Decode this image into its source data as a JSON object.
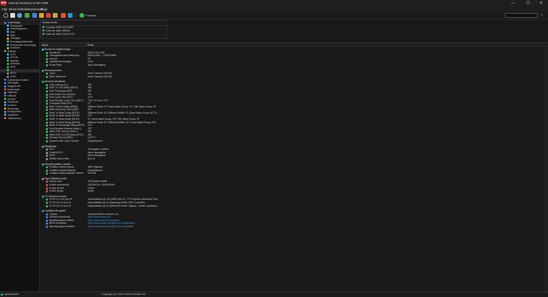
{
  "window": {
    "logo": "AIDA",
    "title": "AIDA64 Extreme v7.60.7300",
    "minimize": "—",
    "maximize": "☐",
    "close": "✕"
  },
  "menu": [
    "Fájl",
    "Nézet",
    "Jelentés",
    "Kedvencek",
    "Súgó"
  ],
  "toolbar": {
    "updates_label": "Frissítés",
    "search_placeholder": "",
    "search_icon": "⌕",
    "icons": [
      "refresh-icon",
      "report-icon",
      "cloud-icon",
      "monitor-icon",
      "cpu-icon",
      "folder-icon",
      "sensor-icon",
      "memory-icon",
      "benchmark-icon",
      "monitor-diag-icon",
      "update-icon"
    ]
  },
  "sidebar": {
    "header": "",
    "items": [
      {
        "label": "Számítógép",
        "indent": 0,
        "color": "#3a7bd5",
        "expanded": true
      },
      {
        "label": "Összegzés",
        "indent": 1,
        "color": "#4aa3df"
      },
      {
        "label": "Számítógépnév",
        "indent": 1,
        "color": "#4aa3df"
      },
      {
        "label": "DMI",
        "indent": 1,
        "color": "#4aa3df"
      },
      {
        "label": "IPMI",
        "indent": 1,
        "color": "#4aa3df"
      },
      {
        "label": "Túlhajtás",
        "indent": 1,
        "color": "#e0a030"
      },
      {
        "label": "Energiagazdálkodás",
        "indent": 1,
        "color": "#5ab04a"
      },
      {
        "label": "Hordozható számítógép",
        "indent": 1,
        "color": "#4aa3df"
      },
      {
        "label": "Érzékelő",
        "indent": 1,
        "color": "#d9a03a"
      },
      {
        "label": "Alaplap",
        "indent": 0,
        "color": "#3aa55a",
        "expanded": true
      },
      {
        "label": "CPU",
        "indent": 1,
        "color": "#4aa3df"
      },
      {
        "label": "CPUID",
        "indent": 1,
        "color": "#4aa3df"
      },
      {
        "label": "Alaplap",
        "indent": 1,
        "color": "#3aa55a"
      },
      {
        "label": "Memória",
        "indent": 1,
        "color": "#3aa55a"
      },
      {
        "label": "SPD",
        "indent": 1,
        "color": "#3aa55a"
      },
      {
        "label": "",
        "indent": 1,
        "color": "#3aa55a",
        "selected": true
      },
      {
        "label": "BIOS",
        "indent": 1,
        "color": "#888"
      },
      {
        "label": "ACPI",
        "indent": 1,
        "color": "#888"
      },
      {
        "label": "Operációs rendszer",
        "indent": 0,
        "color": "#3a7bd5"
      },
      {
        "label": "Kiszolgáló",
        "indent": 0,
        "color": "#3a7bd5"
      },
      {
        "label": "Megjelenítő",
        "indent": 0,
        "color": "#3a7bd5"
      },
      {
        "label": "Multimédia",
        "indent": 0,
        "color": "#c05050"
      },
      {
        "label": "Háttértár",
        "indent": 0,
        "color": "#888"
      },
      {
        "label": "Hálózat",
        "indent": 0,
        "color": "#3a7bd5"
      },
      {
        "label": "DirectX",
        "indent": 0,
        "color": "#5ab04a"
      },
      {
        "label": "Eszközök",
        "indent": 0,
        "color": "#4aa3df"
      },
      {
        "label": "Szoftver",
        "indent": 0,
        "color": "#4aa3df"
      },
      {
        "label": "Biztonság",
        "indent": 0,
        "color": "#d9a03a"
      },
      {
        "label": "Konfiguráció",
        "indent": 0,
        "color": "#888"
      },
      {
        "label": "Adatbázis",
        "indent": 0,
        "color": "#4aa3df"
      },
      {
        "label": "Teljesítmény",
        "indent": 0,
        "color": "#e05050"
      }
    ]
  },
  "devices": {
    "header": "Eszköz leírás",
    "items": [
      "Cpuírás: AMD K19.6 IMC",
      "Dolk hid: AMD SB5XE",
      "Dolk hid: AMD K19.6 FCH"
    ]
  },
  "columns": {
    "field": "Mező",
    "value": "Érték"
  },
  "rows": [
    {
      "t": "sec",
      "label": "Északi hid tulajdonságai",
      "color": "#4aa3df"
    },
    {
      "t": "item",
      "label": "Északi híd",
      "value": "AMD K19.6 IMC",
      "color": "#3aa55a"
    },
    {
      "t": "item",
      "label": "Támogatott memóriatípusok",
      "value": "DDR5-3000 ... DDR5-5600",
      "color": "#3aa55a"
    },
    {
      "t": "item",
      "label": "Revízió",
      "value": "00",
      "color": "#3aa55a"
    },
    {
      "t": "item",
      "label": "Gyártási technológia",
      "value": "5 nm",
      "color": "#3aa55a"
    },
    {
      "t": "item",
      "label": "Probe Filter",
      "value": "Nincs támogatva",
      "color": "#3aa55a"
    },
    {
      "t": "gap"
    },
    {
      "t": "sec",
      "label": "Memóriavezérlő",
      "color": "#3aa55a"
    },
    {
      "t": "item",
      "label": "Típus",
      "value": "Dual Channel (128 bit)",
      "color": "#3aa55a"
    },
    {
      "t": "item",
      "label": "Aktív üzemmód",
      "value": "Dual Channel (128 bit)",
      "color": "#3aa55a"
    },
    {
      "t": "gap"
    },
    {
      "t": "sec",
      "label": "Memória időzítések",
      "color": "#3aa55a"
    },
    {
      "t": "item",
      "label": "CAS Latency (CL)",
      "value": "38T",
      "color": "#3aa55a"
    },
    {
      "t": "item",
      "label": "RAS To CAS Delay (tRCD)",
      "value": "38T",
      "color": "#3aa55a"
    },
    {
      "t": "item",
      "label": "RAS Precharge (tRP)",
      "value": "38T",
      "color": "#3aa55a"
    },
    {
      "t": "item",
      "label": "RAS Active Time (tRAS)",
      "value": "76T",
      "color": "#3aa55a"
    },
    {
      "t": "item",
      "label": "Row Cycle Time (tRC)",
      "value": "112T",
      "color": "#3aa55a"
    },
    {
      "t": "item",
      "label": "Row Refresh Cycle Time (tRFC)",
      "value": "712T, 2x Fine 712T",
      "color": "#3aa55a"
    },
    {
      "t": "item",
      "label": "Command Rate (CR)",
      "value": "1T",
      "color": "#3aa55a"
    },
    {
      "t": "item",
      "label": "RAS To RAS Delay (tRRD)",
      "value": "Different Rank: 0T, Same Bank Group: 11T, Diff. Bank Group: 8T",
      "color": "#3aa55a"
    },
    {
      "t": "item",
      "label": "Write Recovery Time (tWR)",
      "value": "90T",
      "color": "#3aa55a"
    },
    {
      "t": "item",
      "label": "Read To Read Delay (tRTR)",
      "value": "Different Rank: 8T, Different DIMM: 9T, Same Bank Group: 8T, Di...",
      "color": "#3aa55a"
    },
    {
      "t": "item",
      "label": "Read To Write Delay (tRTW)",
      "value": "22T",
      "color": "#3aa55a"
    },
    {
      "t": "item",
      "label": "Write To Read Delay (tWTR)",
      "value": "6T, Same Bank Group: 20T, Diff. Bank Group: 6T",
      "color": "#3aa55a"
    },
    {
      "t": "item",
      "label": "Write To Write Delay (tWTW)",
      "value": "Different Rank: 8T, Different DIMM: 10T, Same Bank Group: 2ST...",
      "color": "#3aa55a"
    },
    {
      "t": "item",
      "label": "Read To Precharge Delay (tRTP)",
      "value": "23T",
      "color": "#3aa55a"
    },
    {
      "t": "item",
      "label": "Four Activate Window Delay (...",
      "value": "32T",
      "color": "#3aa55a"
    },
    {
      "t": "item",
      "label": "Write CAS Latency (tWCL)",
      "value": "36T",
      "color": "#3aa55a"
    },
    {
      "t": "item",
      "label": "Write RAS To CAS Delay (tRCD...",
      "value": "38T",
      "color": "#3aa55a"
    },
    {
      "t": "item",
      "label": "Refresh Period (tREF)",
      "value": "11677T",
      "color": "#3aa55a"
    },
    {
      "t": "item",
      "label": "Dynamic Idle Cycle Counter",
      "value": "Engedélyezve",
      "color": "#3aa55a"
    },
    {
      "t": "gap"
    },
    {
      "t": "sec",
      "label": "Hibajavítás",
      "color": "#3aa55a"
    },
    {
      "t": "item",
      "label": "ECC",
      "value": "Támogatva, Letiltva",
      "color": "#888"
    },
    {
      "t": "item",
      "label": "ChipKill ECC",
      "value": "Nincs támogatva",
      "color": "#888"
    },
    {
      "t": "item",
      "label": "RAID",
      "value": "Nincs támogatva",
      "color": "#888"
    },
    {
      "t": "item",
      "label": "DRAM Scrub Rate",
      "value": "640 ns",
      "color": "#888"
    },
    {
      "t": "gap"
    },
    {
      "t": "sec",
      "label": "Integrált grafikus vezérlő",
      "color": "#3aa55a"
    },
    {
      "t": "item",
      "label": "Grafikus vezérlő típusa",
      "value": "AMD Raphael",
      "color": "#3aa55a"
    },
    {
      "t": "item",
      "label": "Grafikus vezérlő állapota",
      "value": "Engedélyezve",
      "color": "#3aa55a"
    },
    {
      "t": "item",
      "label": "Grafikus képkockapuffer mérete",
      "value": "512 MB",
      "color": "#3aa55a"
    },
    {
      "t": "gap"
    },
    {
      "t": "sec",
      "label": "High Definition Audio",
      "color": "#888"
    },
    {
      "t": "item",
      "label": "Kodek neve",
      "value": "ATI Radeon HDMI",
      "color": "#c05050"
    },
    {
      "t": "item",
      "label": "Kodek azonosítója",
      "value": "1002AA01h / 00AA0100h",
      "color": "#c05050"
    },
    {
      "t": "item",
      "label": "Kodek revízió",
      "value": "1000h",
      "color": "#c05050"
    },
    {
      "t": "item",
      "label": "Kodek típusa",
      "value": "Audio",
      "color": "#c05050"
    },
    {
      "t": "gap"
    },
    {
      "t": "sec",
      "label": "PCI Express vezérlő",
      "color": "#3aa55a"
    },
    {
      "t": "item",
      "label": "PCI-E 5.0 x16 port #1",
      "value": "Használatban @ x16 (AMD Navi 10 - PCI Express Upstream Swit...",
      "color": "#3aa55a"
    },
    {
      "t": "item",
      "label": "PCI-E 5.0 x4 port #1",
      "value": "Használatban @ x4 (Samsung NVMe SSD Controller)",
      "color": "#3aa55a"
    },
    {
      "t": "item",
      "label": "PCI-E 5.0 x4 port #1",
      "value": "Használatban @ x4 (AMD 600 Series Chipset - Switch Upstream ...",
      "color": "#3aa55a"
    },
    {
      "t": "gap"
    },
    {
      "t": "sec",
      "label": "Lapkakészlet gyártó",
      "color": "#3a7bd5"
    },
    {
      "t": "item",
      "label": "Cégnév",
      "value": "Advanced Micro Devices, Inc.",
      "color": "#3a7bd5"
    },
    {
      "t": "item",
      "label": "Termék információk",
      "value": "https://www.amd.com",
      "link": true,
      "color": "#3a7bd5"
    },
    {
      "t": "item",
      "label": "Illesztőprogram letöltés",
      "value": "https://www.amd.com/support",
      "link": true,
      "color": "#3a7bd5"
    },
    {
      "t": "item",
      "label": "BIOS frissítések",
      "value": "http://www.aida64.com/goto/?p=biosupdates",
      "link": true,
      "color": "#3a7bd5"
    },
    {
      "t": "item",
      "label": "Illesztőprogram frissítés",
      "value": "http://www.aida64.com/goto/?p=drvupdates",
      "link": true,
      "color": "#3a7bd5"
    }
  ],
  "status": {
    "left": "Lapkakészlet",
    "center": "Copyright (c) 1995-2025 FinalWire Ltd."
  }
}
